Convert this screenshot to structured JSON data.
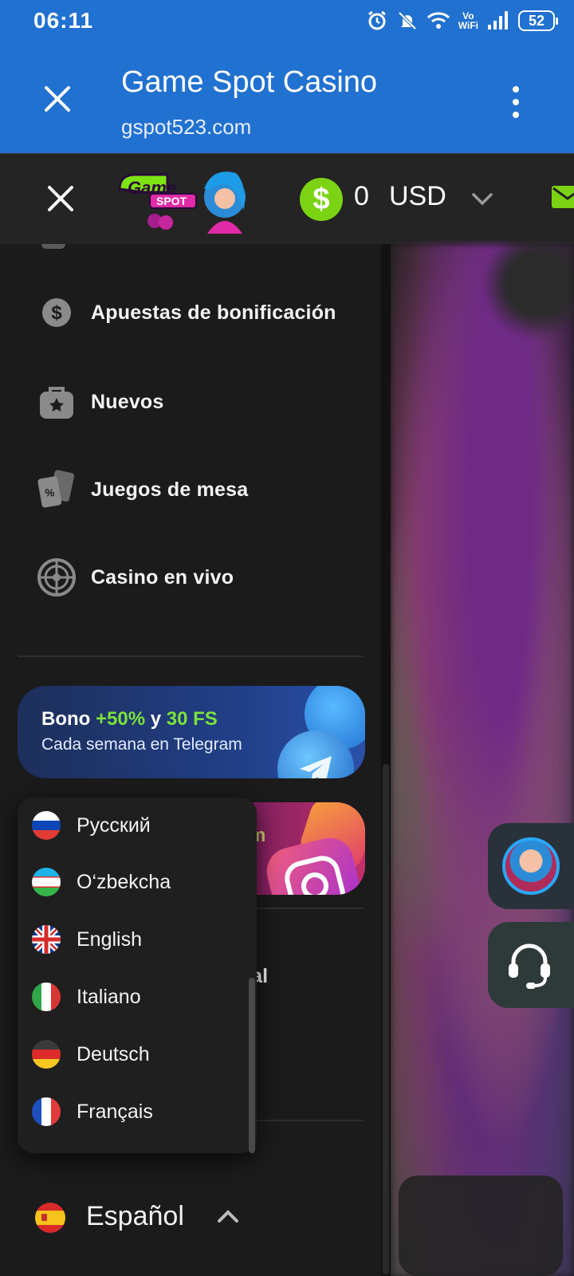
{
  "status_bar": {
    "time": "06:11",
    "wifi_label_top": "Vo",
    "wifi_label_bottom": "WiFi",
    "battery": "52",
    "icons": [
      "alarm-icon",
      "mute-icon",
      "wifi-icon",
      "signal-icon",
      "battery-icon"
    ]
  },
  "browser": {
    "title": "Game Spot Casino",
    "url": "gspot523.com"
  },
  "header": {
    "logo_text_top": "Game",
    "logo_text_bottom": "SPOT",
    "balance_symbol": "$",
    "balance_amount": "0",
    "balance_currency": "USD",
    "accent_color": "#7bd314"
  },
  "sidebar": {
    "items": [
      {
        "label": "Apuestas de bonificación",
        "icon": "dollar-coin-icon"
      },
      {
        "label": "Nuevos",
        "icon": "star-bag-icon"
      },
      {
        "label": "Juegos de mesa",
        "icon": "cards-icon"
      },
      {
        "label": "Casino en vivo",
        "icon": "roulette-icon"
      }
    ],
    "promo_telegram": {
      "prefix": "Bono",
      "highlight1": "+50%",
      "middle": "y",
      "highlight2": "30 FS",
      "subtitle": "Cada semana en Telegram"
    },
    "promo_instagram_partial": "m",
    "behind_dropdown_text": "nal"
  },
  "languages": {
    "options": [
      {
        "label": "Русский",
        "flag": "ru"
      },
      {
        "label": "O‘zbekcha",
        "flag": "uz"
      },
      {
        "label": "English",
        "flag": "gb"
      },
      {
        "label": "Italiano",
        "flag": "it"
      },
      {
        "label": "Deutsch",
        "flag": "de"
      },
      {
        "label": "Français",
        "flag": "fr"
      }
    ],
    "current": {
      "label": "Español",
      "flag": "es"
    }
  }
}
